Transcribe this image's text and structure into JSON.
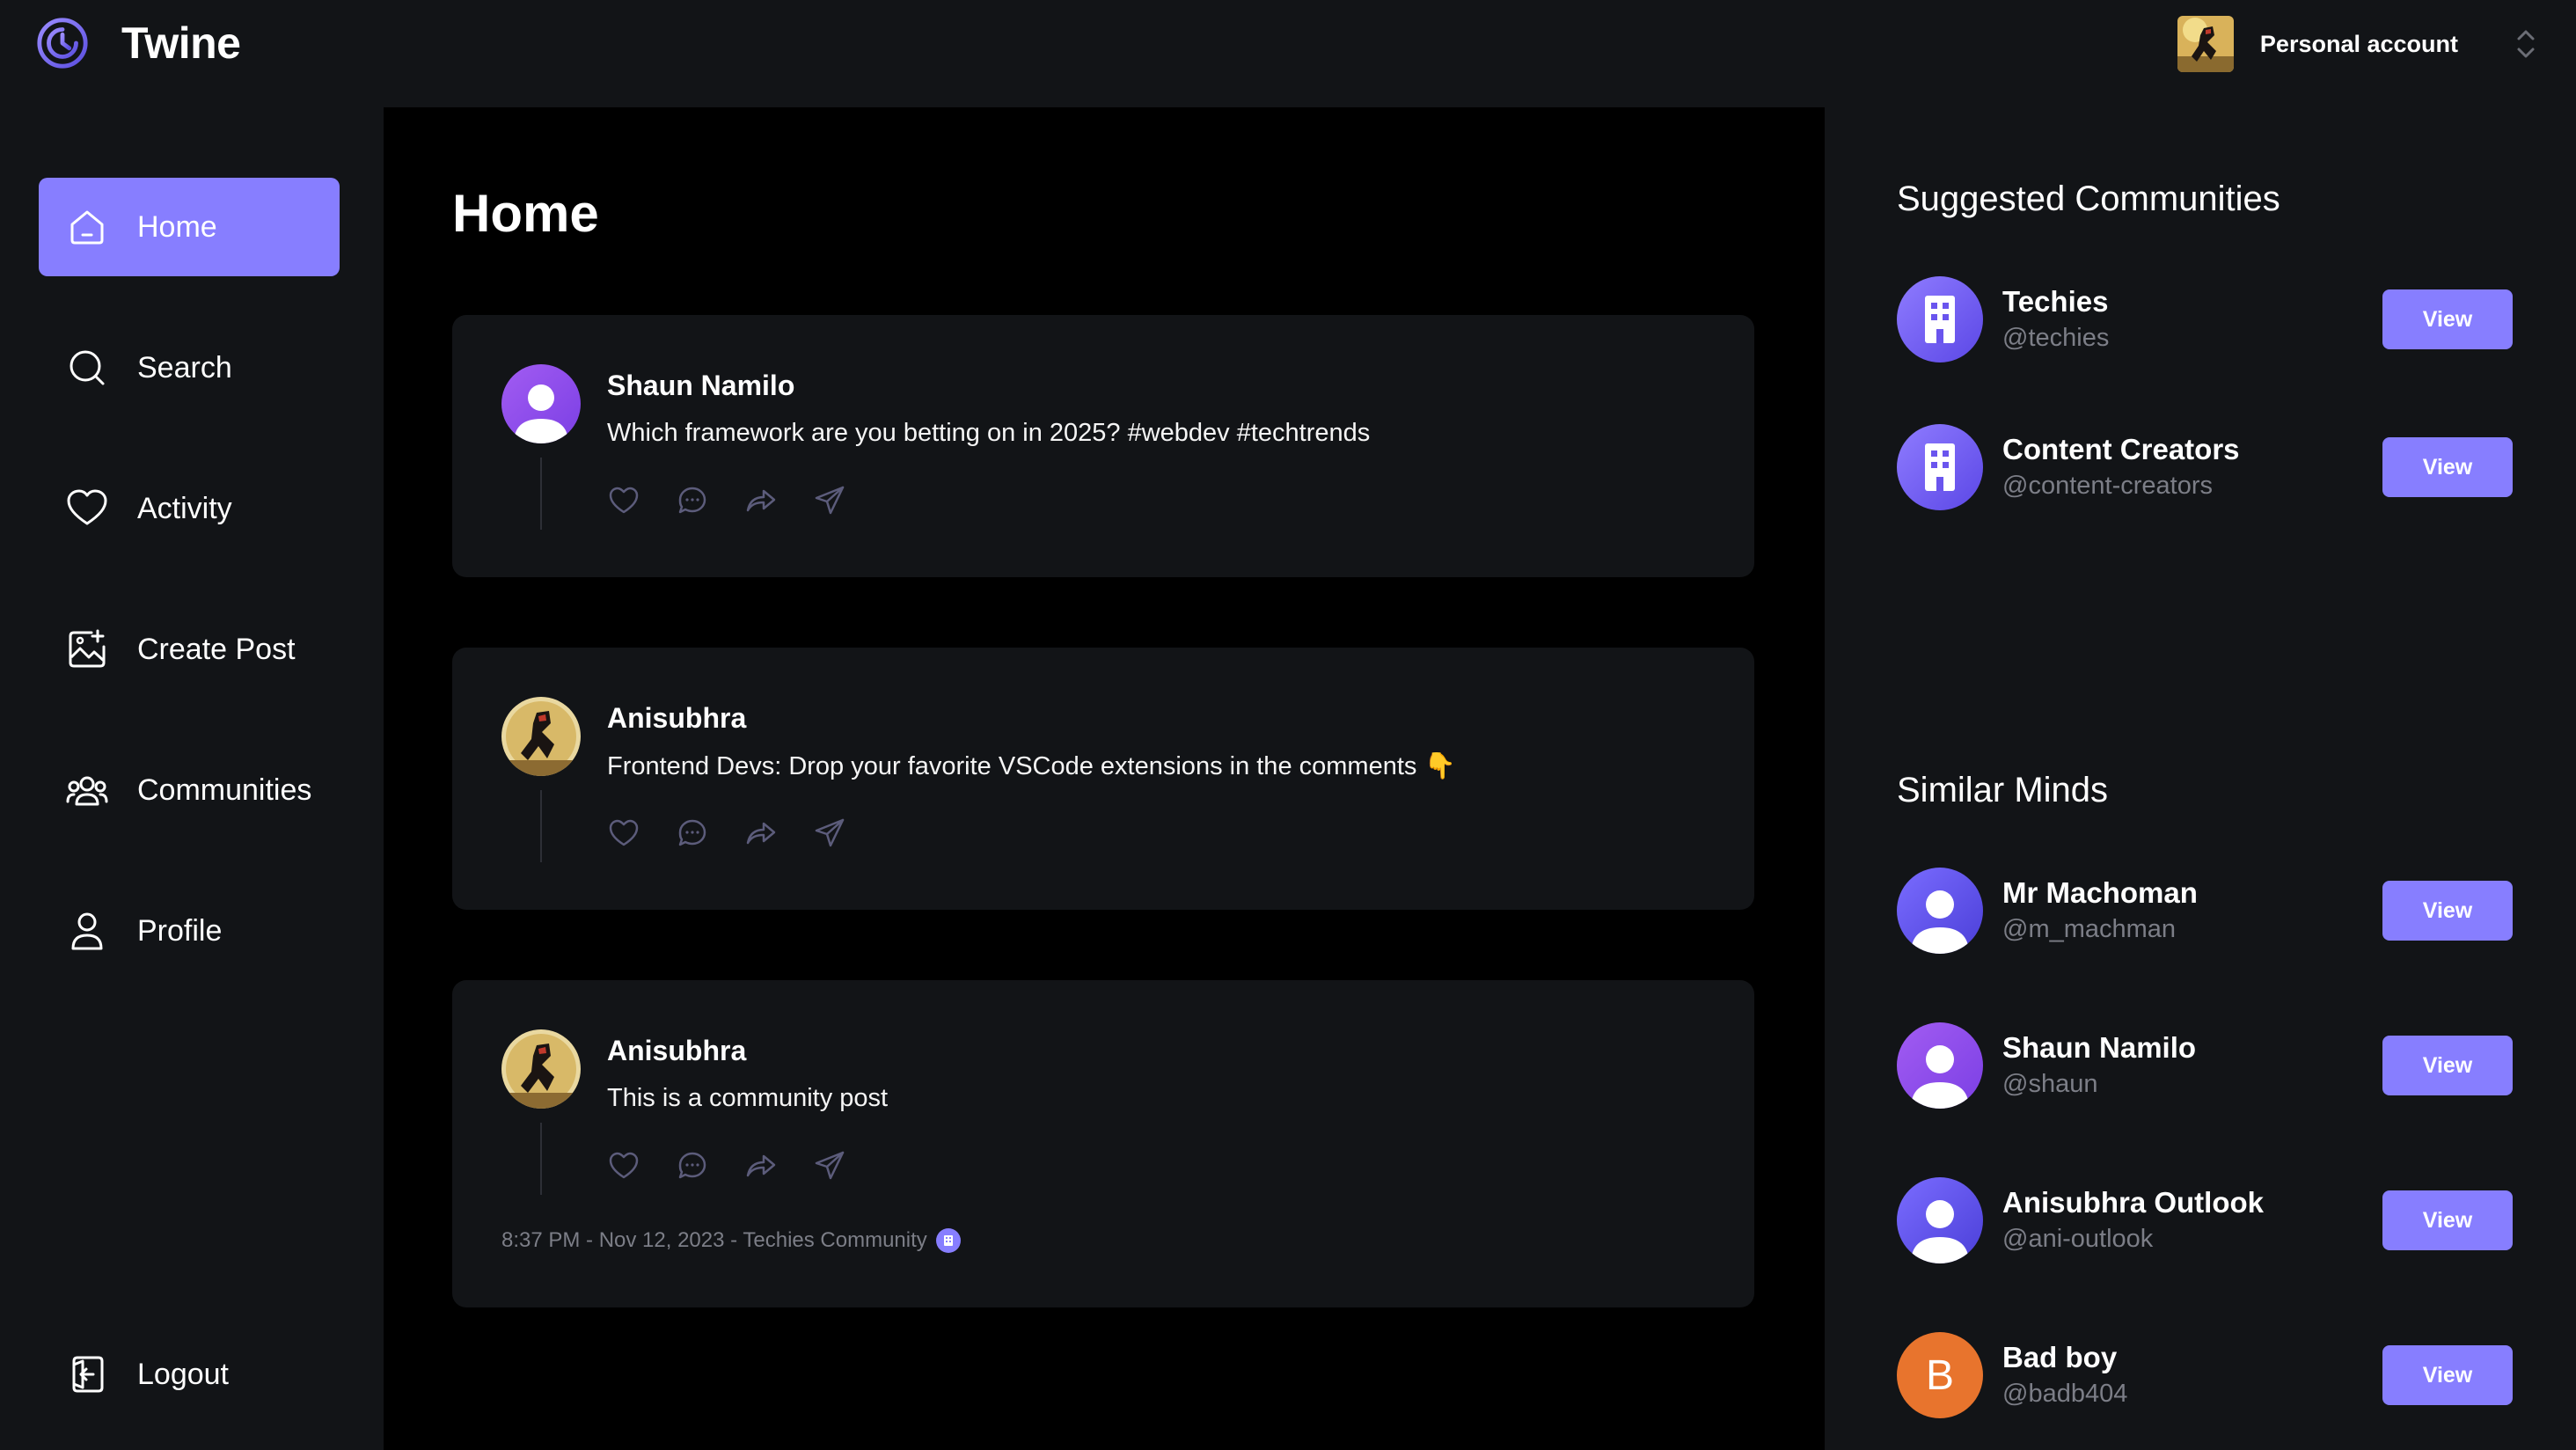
{
  "app": {
    "name": "Twine",
    "logo_icon": "twine-logo-icon"
  },
  "account": {
    "label": "Personal account",
    "avatar_icon": "user-avatar",
    "switch_icon": "chevron-updown-icon"
  },
  "nav": {
    "items": [
      {
        "label": "Home",
        "icon": "home-icon",
        "active": true
      },
      {
        "label": "Search",
        "icon": "search-icon",
        "active": false
      },
      {
        "label": "Activity",
        "icon": "heart-icon",
        "active": false
      },
      {
        "label": "Create Post",
        "icon": "create-post-icon",
        "active": false
      },
      {
        "label": "Communities",
        "icon": "communities-icon",
        "active": false
      },
      {
        "label": "Profile",
        "icon": "user-icon",
        "active": false
      }
    ],
    "logout": {
      "label": "Logout",
      "icon": "logout-icon"
    }
  },
  "feed": {
    "title": "Home",
    "posts": [
      {
        "author": "Shaun Namilo",
        "text": "Which framework are you betting on in 2025? #webdev #techtrends",
        "avatar": "default-user-avatar",
        "meta": ""
      },
      {
        "author": "Anisubhra",
        "text": "Frontend Devs: Drop your favorite VSCode extensions in the comments 👇",
        "avatar": "anisubhra-avatar",
        "meta": ""
      },
      {
        "author": "Anisubhra",
        "text": "This is a community post",
        "avatar": "anisubhra-avatar",
        "meta": "8:37 PM - Nov 12, 2023 - Techies Community"
      }
    ]
  },
  "suggested_communities": {
    "title": "Suggested Communities",
    "items": [
      {
        "name": "Techies",
        "handle": "@techies",
        "button": "View",
        "avatar": "building-icon"
      },
      {
        "name": "Content Creators",
        "handle": "@content-creators",
        "button": "View",
        "avatar": "building-icon"
      }
    ]
  },
  "similar_minds": {
    "title": "Similar Minds",
    "items": [
      {
        "name": "Mr Machoman",
        "handle": "@m_machman",
        "button": "View",
        "avatar": "default-user-avatar"
      },
      {
        "name": "Shaun Namilo",
        "handle": "@shaun",
        "button": "View",
        "avatar": "default-user-avatar"
      },
      {
        "name": "Anisubhra Outlook",
        "handle": "@ani-outlook",
        "button": "View",
        "avatar": "default-user-avatar"
      },
      {
        "name": "Bad boy",
        "handle": "@badb404",
        "button": "View",
        "avatar": "letter-avatar",
        "initial": "B"
      }
    ]
  },
  "colors": {
    "accent": "#877eff",
    "page_bg": "#121417",
    "feed_bg": "#000000",
    "card_bg": "#121417",
    "muted": "#7c7e87",
    "orange_avatar": "#e8742d"
  }
}
